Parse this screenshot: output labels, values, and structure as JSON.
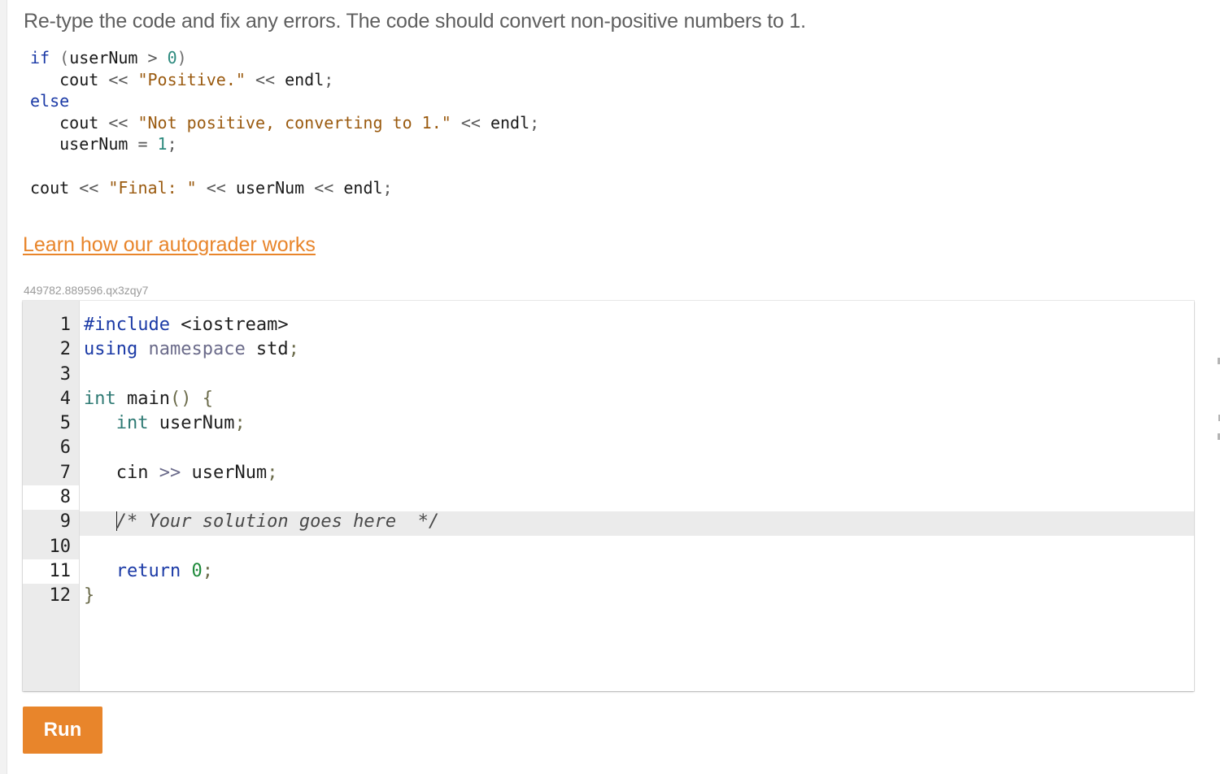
{
  "instructions": "Re-type the code and fix any errors. The code should convert non-positive numbers to 1.",
  "sample_code": {
    "l1_kw": "if",
    "l1_open": " (",
    "l1_var": "userNum",
    "l1_op": " > ",
    "l1_num": "0",
    "l1_close": ")",
    "l2_cout": "   cout ",
    "l2_op1": "<<",
    "l2_str": " \"Positive.\" ",
    "l2_op2": "<<",
    "l2_endl": " endl",
    "l2_semi": ";",
    "l3_kw": "else",
    "l4_cout": "   cout ",
    "l4_op1": "<<",
    "l4_str": " \"Not positive, converting to 1.\" ",
    "l4_op2": "<<",
    "l4_endl": " endl",
    "l4_semi": ";",
    "l5_var": "   userNum ",
    "l5_op": "=",
    "l5_num": " 1",
    "l5_semi": ";",
    "l7_cout": "cout ",
    "l7_op1": "<<",
    "l7_str": " \"Final: \" ",
    "l7_op2": "<<",
    "l7_var": " userNum ",
    "l7_op3": "<<",
    "l7_endl": " endl",
    "l7_semi": ";"
  },
  "learn_link": "Learn how our autograder works",
  "code_id": "449782.889596.qx3zqy7",
  "editor": {
    "line_numbers": [
      "1",
      "2",
      "3",
      "4",
      "5",
      "6",
      "7",
      "8",
      "9",
      "10",
      "11",
      "12"
    ],
    "l1_kw": "#include",
    "l1_rest": " <iostream>",
    "l2_kw": "using",
    "l2_ns": " namespace",
    "l2_std": " std",
    "l2_semi": ";",
    "l4_type": "int",
    "l4_name": " main",
    "l4_parens": "()",
    "l4_brace": " {",
    "l5_indent": "   ",
    "l5_type": "int",
    "l5_var": " userNum",
    "l5_semi": ";",
    "l7_cin": "   cin ",
    "l7_op": ">>",
    "l7_var": " userNum",
    "l7_semi": ";",
    "l9_indent": "   ",
    "l9_comment": "/* Your solution goes here  */",
    "l11_indent": "   ",
    "l11_kw": "return",
    "l11_num": " 0",
    "l11_semi": ";",
    "l12_brace": "}"
  },
  "run_label": "Run"
}
